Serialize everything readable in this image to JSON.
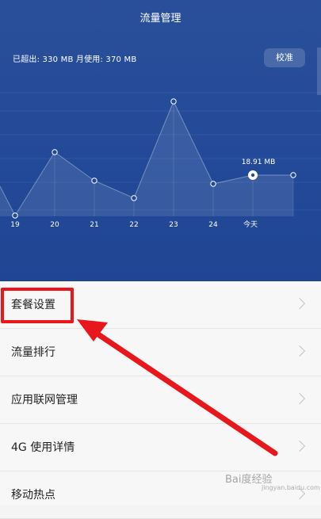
{
  "header": {
    "title": "流量管理",
    "usage_text": "已超出: 330 MB 月使用: 370 MB",
    "calibrate_label": "校准"
  },
  "chart_data": {
    "type": "line",
    "x": [
      "19",
      "20",
      "21",
      "22",
      "23",
      "24",
      "今天"
    ],
    "point_label": "18.91 MB",
    "colors": {
      "background": "#234a98",
      "line": "#ffffff"
    }
  },
  "menu": {
    "items": [
      {
        "label": "套餐设置"
      },
      {
        "label": "流量排行"
      },
      {
        "label": "应用联网管理"
      },
      {
        "label": "4G 使用详情"
      },
      {
        "label": "移动热点"
      }
    ]
  },
  "annotation": {
    "color": "#e8171c",
    "watermark": "Bai度经验",
    "watermark_sub": "jingyan.baidu.com"
  }
}
